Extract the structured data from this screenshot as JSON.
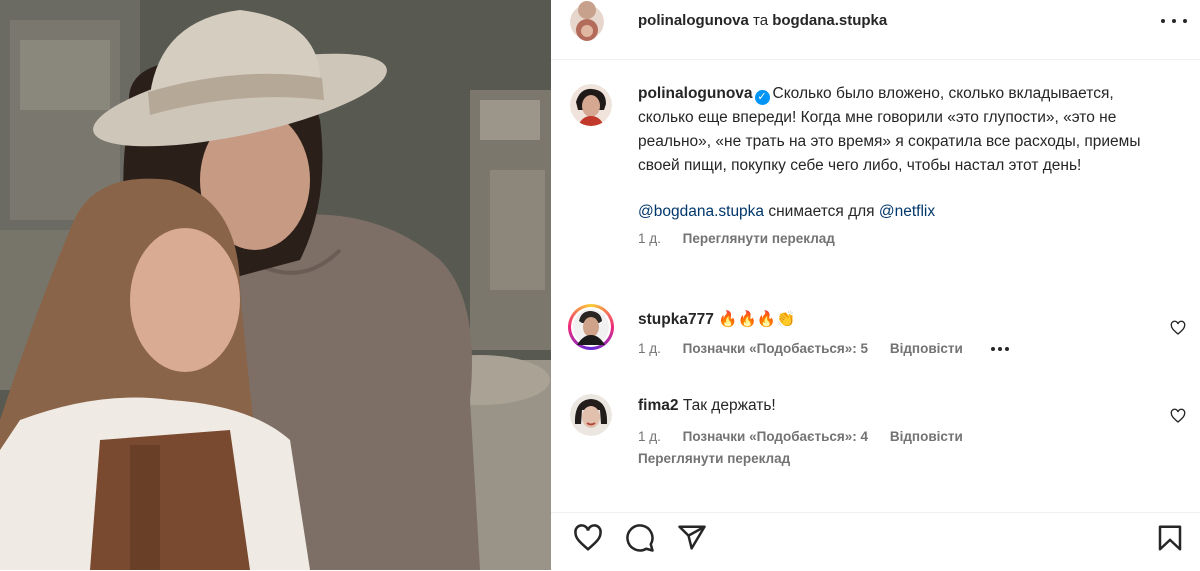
{
  "header": {
    "author": "polinalogunova",
    "conjunction": "та",
    "collaborator": "bogdana.stupka"
  },
  "caption": {
    "username": "polinalogunova",
    "verified_glyph": "✓",
    "text": "Сколько было вложено, сколько вкладывается, сколько еще впереди! Когда мне говорили «это глупости», «это не реально», «не трать на это время» я сократила все расходы, приемы своей пищи, покупку себе чего либо, чтобы настал этот день!",
    "mention1": "@bogdana.stupka",
    "middle": " снимается для ",
    "mention2": "@netflix",
    "time": "1 д.",
    "translate": "Переглянути переклад"
  },
  "comments": [
    {
      "username": "stupka777",
      "text": "🔥🔥🔥👏",
      "time": "1 д.",
      "likes": "Позначки «Подобається»: 5",
      "reply": "Відповісти"
    },
    {
      "username": "fima2",
      "text": "Так держать!",
      "time": "1 д.",
      "likes": "Позначки «Подобається»: 4",
      "reply": "Відповісти",
      "translate": "Переглянути переклад"
    }
  ],
  "icons": {
    "like": "heart-icon",
    "comment": "comment-icon",
    "share": "share-icon",
    "save": "bookmark-icon",
    "more": "more-icon"
  }
}
